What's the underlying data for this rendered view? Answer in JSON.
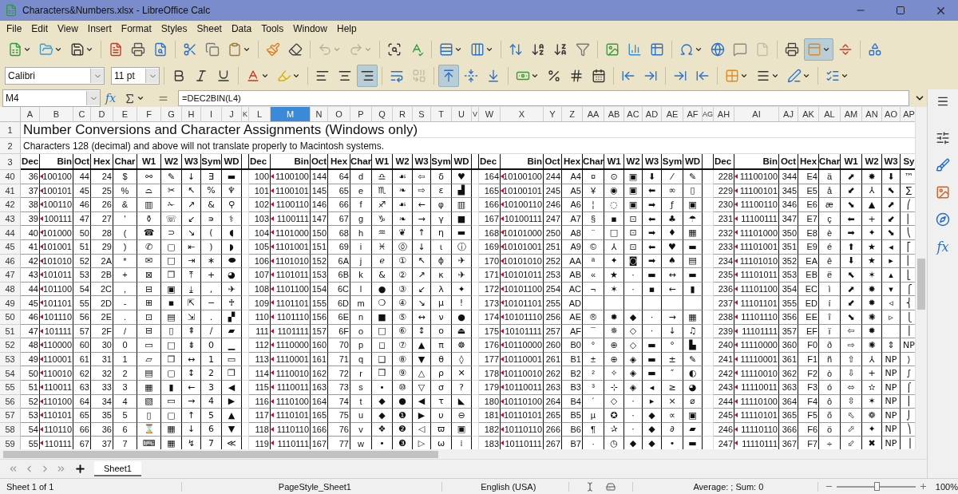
{
  "window": {
    "title": "Characters&Numbers.xlsx - LibreOffice Calc"
  },
  "menu": [
    "File",
    "Edit",
    "View",
    "Insert",
    "Format",
    "Styles",
    "Sheet",
    "Data",
    "Tools",
    "Window",
    "Help"
  ],
  "toolbar_states": {
    "undo_disabled": true,
    "redo_disabled": true,
    "headers_disabled": true,
    "merge_disabled": true,
    "freeze_pressed": true,
    "align_right_pressed": true,
    "align_top_pressed": true
  },
  "font_name": {
    "value": "Calibri"
  },
  "font_size": {
    "value": "11 pt"
  },
  "formula_bar": {
    "cell_ref": "M4",
    "function_wizard": "fx",
    "formula": "=DEC2BIN(L4)"
  },
  "sheet": {
    "columns": [
      {
        "label": "A",
        "selected": false
      },
      {
        "label": "B",
        "selected": false
      },
      {
        "label": "C",
        "selected": false
      },
      {
        "label": "D",
        "selected": false
      },
      {
        "label": "E",
        "selected": false
      },
      {
        "label": "F",
        "selected": false
      },
      {
        "label": "G",
        "selected": false
      },
      {
        "label": "H",
        "selected": false
      },
      {
        "label": "I",
        "selected": false
      },
      {
        "label": "J",
        "selected": false
      },
      {
        "label": "K",
        "selected": false
      },
      {
        "label": "L",
        "selected": false
      },
      {
        "label": "M",
        "selected": true
      },
      {
        "label": "N",
        "selected": false
      },
      {
        "label": "O",
        "selected": false
      },
      {
        "label": "P",
        "selected": false
      },
      {
        "label": "Q",
        "selected": false
      },
      {
        "label": "R",
        "selected": false
      },
      {
        "label": "S",
        "selected": false
      },
      {
        "label": "T",
        "selected": false
      },
      {
        "label": "U",
        "selected": false
      },
      {
        "label": "V",
        "selected": false
      },
      {
        "label": "W",
        "selected": false
      },
      {
        "label": "X",
        "selected": false
      },
      {
        "label": "Y",
        "selected": false
      },
      {
        "label": "Z",
        "selected": false
      },
      {
        "label": "AA",
        "selected": false
      },
      {
        "label": "AB",
        "selected": false
      },
      {
        "label": "AC",
        "selected": false
      },
      {
        "label": "AD",
        "selected": false
      },
      {
        "label": "AE",
        "selected": false
      },
      {
        "label": "AF",
        "selected": false
      },
      {
        "label": "AG",
        "selected": false
      },
      {
        "label": "AH",
        "selected": false
      },
      {
        "label": "AI",
        "selected": false
      },
      {
        "label": "AJ",
        "selected": false
      },
      {
        "label": "AK",
        "selected": false
      },
      {
        "label": "AL",
        "selected": false
      },
      {
        "label": "AM",
        "selected": false
      },
      {
        "label": "AN",
        "selected": false
      },
      {
        "label": "AO",
        "selected": false
      },
      {
        "label": "AP",
        "selected": false
      }
    ],
    "row_headers": [
      "1",
      "2",
      "3",
      "40",
      "41",
      "42",
      "43",
      "44",
      "45",
      "46",
      "47",
      "48",
      "49",
      "50",
      "51",
      "52",
      "53",
      "54",
      "55",
      "56",
      "57",
      "58",
      "59"
    ],
    "title": "Number Conversions and Character Assignments (Windows only)",
    "subtitle": "Characters 128 (decimal) and above will not translate properly to Macintosh systems.",
    "blocks": [
      {
        "bin_marked": true,
        "headers": [
          "Dec",
          "Bin",
          "Oct",
          "Hex",
          "Char",
          "W1",
          "W2",
          "W3",
          "Sym",
          "WD"
        ],
        "rows": [
          {
            "dec": "36",
            "bin": "100100",
            "oct": "44",
            "hex": "24",
            "char": "$",
            "w1": "⚯",
            "w2": "✎",
            "w3": "↓",
            "sym": "∃",
            "wd": "▬"
          },
          {
            "dec": "37",
            "bin": "100101",
            "oct": "45",
            "hex": "25",
            "char": "%",
            "w1": "⌓",
            "w2": "✂",
            "w3": "↖",
            "sym": "%",
            "wd": "♆"
          },
          {
            "dec": "38",
            "bin": "100110",
            "oct": "46",
            "hex": "26",
            "char": "&",
            "w1": "▥",
            "w2": "✁",
            "w3": "↗",
            "sym": "&",
            "wd": "⚲"
          },
          {
            "dec": "39",
            "bin": "100111",
            "oct": "47",
            "hex": "27",
            "char": "'",
            "w1": "⚱",
            "w2": "☏",
            "w3": "↙",
            "sym": "∍",
            "wd": "⚕"
          },
          {
            "dec": "40",
            "bin": "101000",
            "oct": "50",
            "hex": "28",
            "char": "(",
            "w1": "☎",
            "w2": "⊃",
            "w3": "↘",
            "sym": "(",
            "wd": "◖"
          },
          {
            "dec": "41",
            "bin": "101001",
            "oct": "51",
            "hex": "29",
            "char": ")",
            "w1": "✆",
            "w2": "▢",
            "w3": "⇤",
            "sym": ")",
            "wd": "◗"
          },
          {
            "dec": "42",
            "bin": "101010",
            "oct": "52",
            "hex": "2A",
            "char": "*",
            "w1": "✉",
            "w2": "□",
            "w3": "⇥",
            "sym": "∗",
            "wd": "⬬"
          },
          {
            "dec": "43",
            "bin": "101011",
            "oct": "53",
            "hex": "2B",
            "char": "+",
            "w1": "⊠",
            "w2": "❐",
            "w3": "⤒",
            "sym": "+",
            "wd": "◕"
          },
          {
            "dec": "44",
            "bin": "101100",
            "oct": "54",
            "hex": "2C",
            "char": ",",
            "w1": "⊟",
            "w2": "▣",
            "w3": "⤓",
            "sym": ",",
            "wd": "✈"
          },
          {
            "dec": "45",
            "bin": "101101",
            "oct": "55",
            "hex": "2D",
            "char": "-",
            "w1": "⊞",
            "w2": "▪",
            "w3": "⇱",
            "sym": "−",
            "wd": "♰"
          },
          {
            "dec": "46",
            "bin": "101110",
            "oct": "56",
            "hex": "2E",
            "char": ".",
            "w1": "⊡",
            "w2": "▤",
            "w3": "⇲",
            "sym": ".",
            "wd": "▞"
          },
          {
            "dec": "47",
            "bin": "101111",
            "oct": "57",
            "hex": "2F",
            "char": "/",
            "w1": "⊟",
            "w2": "▯",
            "w3": "⇞",
            "sym": "/",
            "wd": "▰"
          },
          {
            "dec": "48",
            "bin": "110000",
            "oct": "60",
            "hex": "30",
            "char": "0",
            "w1": "▭",
            "w2": "□",
            "w3": "⇟",
            "sym": "0",
            "wd": "▁"
          },
          {
            "dec": "49",
            "bin": "110001",
            "oct": "61",
            "hex": "31",
            "char": "1",
            "w1": "▱",
            "w2": "❐",
            "w3": "↔",
            "sym": "1",
            "wd": "▭"
          },
          {
            "dec": "50",
            "bin": "110010",
            "oct": "62",
            "hex": "32",
            "char": "2",
            "w1": "▤",
            "w2": "▢",
            "w3": "↕",
            "sym": "2",
            "wd": "❐"
          },
          {
            "dec": "51",
            "bin": "110011",
            "oct": "63",
            "hex": "33",
            "char": "3",
            "w1": "▦",
            "w2": "▮",
            "w3": "←",
            "sym": "3",
            "wd": "◀"
          },
          {
            "dec": "52",
            "bin": "110100",
            "oct": "64",
            "hex": "34",
            "char": "4",
            "w1": "▧",
            "w2": "▭",
            "w3": "→",
            "sym": "4",
            "wd": "▶"
          },
          {
            "dec": "53",
            "bin": "110101",
            "oct": "65",
            "hex": "35",
            "char": "5",
            "w1": "▯",
            "w2": "▢",
            "w3": "↑",
            "sym": "5",
            "wd": "▲"
          },
          {
            "dec": "54",
            "bin": "110110",
            "oct": "66",
            "hex": "36",
            "char": "6",
            "w1": "⌛",
            "w2": "▦",
            "w3": "↓",
            "sym": "6",
            "wd": "▼"
          },
          {
            "dec": "55",
            "bin": "110111",
            "oct": "67",
            "hex": "37",
            "char": "7",
            "w1": "⌨",
            "w2": "▦",
            "w3": "↯",
            "sym": "7",
            "wd": "≪"
          }
        ]
      },
      {
        "bin_marked": true,
        "headers": [
          "Dec",
          "Bin",
          "Oct",
          "Hex",
          "Char",
          "W1",
          "W2",
          "W3",
          "Sym",
          "WD"
        ],
        "rows": [
          {
            "dec": "100",
            "bin": "1100100",
            "oct": "144",
            "hex": "64",
            "char": "d",
            "w1": "♎",
            "w2": "☙",
            "w3": "⇦",
            "sym": "δ",
            "wd": "♥"
          },
          {
            "dec": "101",
            "bin": "1100101",
            "oct": "145",
            "hex": "65",
            "char": "e",
            "w1": "♏",
            "w2": "❧",
            "w3": "⇨",
            "sym": "ε",
            "wd": "▟"
          },
          {
            "dec": "102",
            "bin": "1100110",
            "oct": "146",
            "hex": "66",
            "char": "f",
            "w1": "♐",
            "w2": "☙",
            "w3": "←",
            "sym": "φ",
            "wd": "▥"
          },
          {
            "dec": "103",
            "bin": "1100111",
            "oct": "147",
            "hex": "67",
            "char": "g",
            "w1": "♑",
            "w2": "❧",
            "w3": "→",
            "sym": "γ",
            "wd": "■"
          },
          {
            "dec": "104",
            "bin": "1101000",
            "oct": "150",
            "hex": "68",
            "char": "h",
            "w1": "♒",
            "w2": "❦",
            "w3": "↑",
            "sym": "η",
            "wd": "▬"
          },
          {
            "dec": "105",
            "bin": "1101001",
            "oct": "151",
            "hex": "69",
            "char": "i",
            "w1": "♓",
            "w2": "⓪",
            "w3": "↓",
            "sym": "ι",
            "wd": "ⓘ"
          },
          {
            "dec": "106",
            "bin": "1101010",
            "oct": "152",
            "hex": "6A",
            "char": "j",
            "w1": "ℯ",
            "w2": "①",
            "w3": "↖",
            "sym": "ϕ",
            "wd": "✈"
          },
          {
            "dec": "107",
            "bin": "1101011",
            "oct": "153",
            "hex": "6B",
            "char": "k",
            "w1": "&",
            "w2": "②",
            "w3": "↗",
            "sym": "κ",
            "wd": "✈"
          },
          {
            "dec": "108",
            "bin": "1101100",
            "oct": "154",
            "hex": "6C",
            "char": "l",
            "w1": "●",
            "w2": "③",
            "w3": "↙",
            "sym": "λ",
            "wd": "✦"
          },
          {
            "dec": "109",
            "bin": "1101101",
            "oct": "155",
            "hex": "6D",
            "char": "m",
            "w1": "❍",
            "w2": "④",
            "w3": "↘",
            "sym": "μ",
            "wd": "!"
          },
          {
            "dec": "110",
            "bin": "1101110",
            "oct": "156",
            "hex": "6E",
            "char": "n",
            "w1": "■",
            "w2": "⑤",
            "w3": "↔",
            "sym": "ν",
            "wd": "●"
          },
          {
            "dec": "111",
            "bin": "1101111",
            "oct": "157",
            "hex": "6F",
            "char": "o",
            "w1": "□",
            "w2": "⑥",
            "w3": "↕",
            "sym": "ο",
            "wd": "⏏"
          },
          {
            "dec": "112",
            "bin": "1110000",
            "oct": "160",
            "hex": "70",
            "char": "p",
            "w1": "◻",
            "w2": "⑦",
            "w3": "▲",
            "sym": "π",
            "wd": "☸"
          },
          {
            "dec": "113",
            "bin": "1110001",
            "oct": "161",
            "hex": "71",
            "char": "q",
            "w1": "❑",
            "w2": "⑧",
            "w3": "▼",
            "sym": "θ",
            "wd": "◊"
          },
          {
            "dec": "114",
            "bin": "1110010",
            "oct": "162",
            "hex": "72",
            "char": "r",
            "w1": "❒",
            "w2": "⑨",
            "w3": "△",
            "sym": "ρ",
            "wd": "✕"
          },
          {
            "dec": "115",
            "bin": "1110011",
            "oct": "163",
            "hex": "73",
            "char": "s",
            "w1": "•",
            "w2": "⑩",
            "w3": "▽",
            "sym": "σ",
            "wd": "?"
          },
          {
            "dec": "116",
            "bin": "1110100",
            "oct": "164",
            "hex": "74",
            "char": "t",
            "w1": "◆",
            "w2": "●",
            "w3": "◀",
            "sym": "τ",
            "wd": "◣"
          },
          {
            "dec": "117",
            "bin": "1110101",
            "oct": "165",
            "hex": "75",
            "char": "u",
            "w1": "◆",
            "w2": "❶",
            "w3": "▶",
            "sym": "υ",
            "wd": "⊖"
          },
          {
            "dec": "118",
            "bin": "1110110",
            "oct": "166",
            "hex": "76",
            "char": "v",
            "w1": "❖",
            "w2": "❷",
            "w3": "◁",
            "sym": "ϖ",
            "wd": "▣"
          },
          {
            "dec": "119",
            "bin": "1110111",
            "oct": "167",
            "hex": "77",
            "char": "w",
            "w1": "•",
            "w2": "❸",
            "w3": "▷",
            "sym": "ω",
            "wd": "⁞"
          }
        ]
      },
      {
        "bin_marked": true,
        "headers": [
          "Dec",
          "Bin",
          "Oct",
          "Hex",
          "Char",
          "W1",
          "W2",
          "W3",
          "Sym",
          "WD"
        ],
        "rows": [
          {
            "dec": "164",
            "bin": "10100100",
            "oct": "244",
            "hex": "A4",
            "char": "¤",
            "w1": "⊙",
            "w2": "▣",
            "w3": "⬇",
            "sym": "⁄",
            "wd": "✎"
          },
          {
            "dec": "165",
            "bin": "10100101",
            "oct": "245",
            "hex": "A5",
            "char": "¥",
            "w1": "◉",
            "w2": "▣",
            "w3": "⬅",
            "sym": "∞",
            "wd": "▯"
          },
          {
            "dec": "166",
            "bin": "10100110",
            "oct": "246",
            "hex": "A6",
            "char": "¦",
            "w1": "◌",
            "w2": "▣",
            "w3": "➡",
            "sym": "ƒ",
            "wd": "▣"
          },
          {
            "dec": "167",
            "bin": "10100111",
            "oct": "247",
            "hex": "A7",
            "char": "§",
            "w1": "▪",
            "w2": "⊡",
            "w3": "⬅",
            "sym": "♣",
            "wd": "☂"
          },
          {
            "dec": "168",
            "bin": "10101000",
            "oct": "250",
            "hex": "A8",
            "char": "¨",
            "w1": "□",
            "w2": "⊡",
            "w3": "➡",
            "sym": "♦",
            "wd": "▦"
          },
          {
            "dec": "169",
            "bin": "10101001",
            "oct": "251",
            "hex": "A9",
            "char": "©",
            "w1": "⅄",
            "w2": "⊡",
            "w3": "⬅",
            "sym": "♥",
            "wd": "▬"
          },
          {
            "dec": "170",
            "bin": "10101010",
            "oct": "252",
            "hex": "AA",
            "char": "ª",
            "w1": "✦",
            "w2": "◙",
            "w3": "➡",
            "sym": "♠",
            "wd": "▤"
          },
          {
            "dec": "171",
            "bin": "10101011",
            "oct": "253",
            "hex": "AB",
            "char": "«",
            "w1": "★",
            "w2": "·",
            "w3": "▬",
            "sym": "↔",
            "wd": "▬"
          },
          {
            "dec": "172",
            "bin": "10101100",
            "oct": "254",
            "hex": "AC",
            "char": "¬",
            "w1": "✶",
            "w2": "·",
            "w3": "▪",
            "sym": "←",
            "wd": "▮"
          },
          {
            "dec": "173",
            "bin": "10101101",
            "oct": "255",
            "hex": "AD"
          },
          {
            "dec": "174",
            "bin": "10101110",
            "oct": "256",
            "hex": "AE",
            "char": "®",
            "w1": "✹",
            "w2": "◆",
            "w3": "·",
            "sym": "→",
            "wd": "▦"
          },
          {
            "dec": "175",
            "bin": "10101111",
            "oct": "257",
            "hex": "AF",
            "char": "¯",
            "w1": "✵",
            "w2": "◇",
            "w3": "·",
            "sym": "↓",
            "wd": "♫"
          },
          {
            "dec": "176",
            "bin": "10110000",
            "oct": "260",
            "hex": "B0",
            "char": "°",
            "w1": "⊕",
            "w2": "◇",
            "w3": "▬",
            "sym": "°",
            "wd": "▙"
          },
          {
            "dec": "177",
            "bin": "10110001",
            "oct": "261",
            "hex": "B1",
            "char": "±",
            "w1": "⊕",
            "w2": "◈",
            "w3": "▬",
            "sym": "±",
            "wd": "✎"
          },
          {
            "dec": "178",
            "bin": "10110010",
            "oct": "262",
            "hex": "B2",
            "char": "²",
            "w1": "✧",
            "w2": "◈",
            "w3": "▬",
            "sym": "″",
            "wd": "◐"
          },
          {
            "dec": "179",
            "bin": "10110011",
            "oct": "263",
            "hex": "B3",
            "char": "³",
            "w1": "⊹",
            "w2": "◈",
            "w3": "◂",
            "sym": "≥",
            "wd": "◕"
          },
          {
            "dec": "180",
            "bin": "10110100",
            "oct": "264",
            "hex": "B4",
            "char": "´",
            "w1": "◇",
            "w2": "·",
            "w3": "▸",
            "sym": "×",
            "wd": "⌀"
          },
          {
            "dec": "181",
            "bin": "10110101",
            "oct": "265",
            "hex": "B5",
            "char": "µ",
            "w1": "✪",
            "w2": "·",
            "w3": "◆",
            "sym": "∝",
            "wd": "▣"
          },
          {
            "dec": "182",
            "bin": "10110110",
            "oct": "266",
            "hex": "B6",
            "char": "¶",
            "w1": "✰",
            "w2": "·",
            "w3": "◆",
            "sym": "∂",
            "wd": "▰"
          },
          {
            "dec": "183",
            "bin": "10110111",
            "oct": "267",
            "hex": "B7",
            "char": "·",
            "w1": "◷",
            "w2": "◆",
            "w3": "◆",
            "sym": "•",
            "wd": "▬"
          }
        ]
      },
      {
        "bin_marked": true,
        "headers": [
          "Dec",
          "Bin",
          "Oct",
          "Hex",
          "Char",
          "W1",
          "W2",
          "W3",
          "Sy"
        ],
        "rows": [
          {
            "dec": "228",
            "bin": "11100100",
            "oct": "344",
            "hex": "E4",
            "char": "ä",
            "w1": "⬈",
            "w2": "✸",
            "w3": "⬇",
            "sym": "™"
          },
          {
            "dec": "229",
            "bin": "11100101",
            "oct": "345",
            "hex": "E5",
            "char": "å",
            "w1": "⬋",
            "w2": "⅄",
            "w3": "⬉",
            "sym": "∑"
          },
          {
            "dec": "230",
            "bin": "11100110",
            "oct": "346",
            "hex": "E6",
            "char": "æ",
            "w1": "⬊",
            "w2": "▲",
            "w3": "⬈",
            "sym": "⎛"
          },
          {
            "dec": "231",
            "bin": "11100111",
            "oct": "347",
            "hex": "E7",
            "char": "ç",
            "w1": "⬅",
            "w2": "+",
            "w3": "⬋",
            "sym": "⎜"
          },
          {
            "dec": "232",
            "bin": "11101000",
            "oct": "350",
            "hex": "E8",
            "char": "è",
            "w1": "➡",
            "w2": "✦",
            "w3": "⬊",
            "sym": "⎝"
          },
          {
            "dec": "233",
            "bin": "11101001",
            "oct": "351",
            "hex": "E9",
            "char": "é",
            "w1": "⬆",
            "w2": "★",
            "w3": "◂",
            "sym": "⎡"
          },
          {
            "dec": "234",
            "bin": "11101010",
            "oct": "352",
            "hex": "EA",
            "char": "ê",
            "w1": "⬇",
            "w2": "★",
            "w3": "▸",
            "sym": "⎢"
          },
          {
            "dec": "235",
            "bin": "11101011",
            "oct": "353",
            "hex": "EB",
            "char": "ë",
            "w1": "⬉",
            "w2": "✶",
            "w3": "▴",
            "sym": "⎣"
          },
          {
            "dec": "236",
            "bin": "11101100",
            "oct": "354",
            "hex": "EC",
            "char": "ì",
            "w1": "⬈",
            "w2": "✸",
            "w3": "▾",
            "sym": "⎧"
          },
          {
            "dec": "237",
            "bin": "11101101",
            "oct": "355",
            "hex": "ED",
            "char": "í",
            "w1": "⬋",
            "w2": "✹",
            "w3": "◃",
            "sym": "⎨"
          },
          {
            "dec": "238",
            "bin": "11101110",
            "oct": "356",
            "hex": "EE",
            "char": "î",
            "w1": "⬊",
            "w2": "✺",
            "w3": "▹",
            "sym": "⎩"
          },
          {
            "dec": "239",
            "bin": "11101111",
            "oct": "357",
            "hex": "EF",
            "char": "ï",
            "w1": "⇦",
            "w2": "✹",
            "sym": "⎪"
          },
          {
            "dec": "240",
            "bin": "11110000",
            "oct": "360",
            "hex": "F0",
            "char": "ð",
            "w1": "⇨",
            "w2": "✺",
            "w3": "⇕",
            "sym": "NP"
          },
          {
            "dec": "241",
            "bin": "11110001",
            "oct": "361",
            "hex": "F1",
            "char": "ñ",
            "w1": "⇧",
            "w2": "⅄",
            "w3": "NP",
            "sym": "⟩"
          },
          {
            "dec": "242",
            "bin": "11110010",
            "oct": "362",
            "hex": "F2",
            "char": "ò",
            "w1": "⇩",
            "w2": "+",
            "w3": "NP",
            "sym": "∫"
          },
          {
            "dec": "243",
            "bin": "11110011",
            "oct": "363",
            "hex": "F3",
            "char": "ó",
            "w1": "⬄",
            "w2": "✫",
            "w3": "NP",
            "sym": "⌠"
          },
          {
            "dec": "244",
            "bin": "11110100",
            "oct": "364",
            "hex": "F4",
            "char": "ô",
            "w1": "⇳",
            "w2": "✶",
            "w3": "NP",
            "sym": "⎮"
          },
          {
            "dec": "245",
            "bin": "11110101",
            "oct": "365",
            "hex": "F5",
            "char": "õ",
            "w1": "⬁",
            "w2": "❁",
            "w3": "NP",
            "sym": "⌡"
          },
          {
            "dec": "246",
            "bin": "11110110",
            "oct": "366",
            "hex": "F6",
            "char": "ö",
            "w1": "⬀",
            "w2": "✦",
            "w3": "NP",
            "sym": "⎞"
          },
          {
            "dec": "247",
            "bin": "11110111",
            "oct": "367",
            "hex": "F7",
            "char": "÷",
            "w1": "⬃",
            "w2": "✖",
            "w3": "NP",
            "sym": "⎟"
          }
        ]
      }
    ]
  },
  "sheet_tabs": [
    {
      "label": "Sheet1",
      "selected": true
    }
  ],
  "status_bar": {
    "sheet": "Sheet 1 of 1",
    "page_style": "PageStyle_Sheet1",
    "language": "English (USA)",
    "summary": "Average: ; Sum: 0",
    "zoom": {
      "level": 0.5,
      "reading": "100%"
    }
  },
  "sidebar": {
    "functions": "fx"
  }
}
